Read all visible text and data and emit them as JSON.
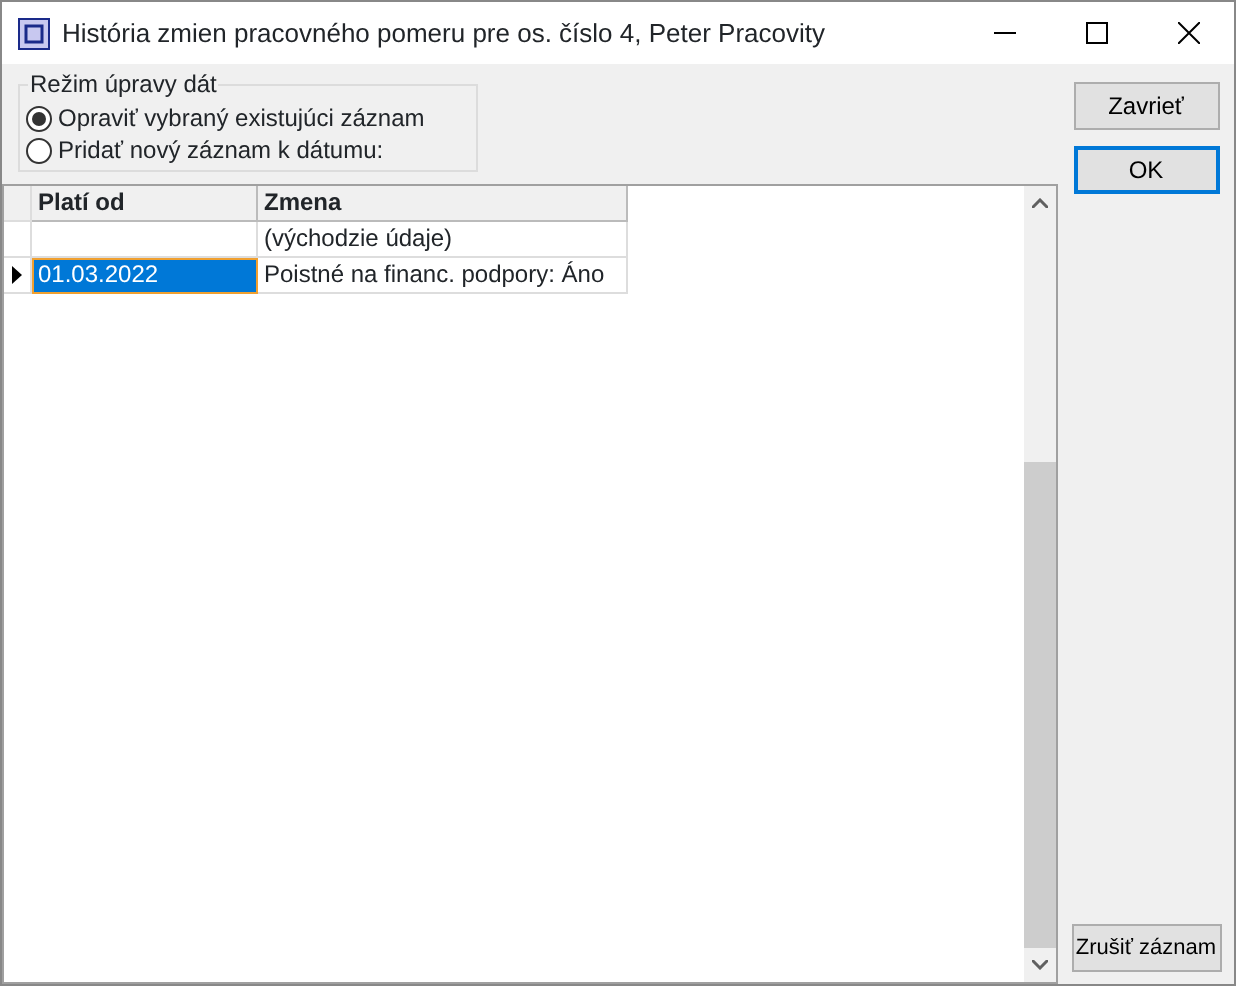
{
  "window": {
    "title": "História zmien pracovného pomeru pre os. číslo 4, Peter Pracovity"
  },
  "mode_group": {
    "title": "Režim úpravy dát",
    "options": [
      {
        "label": "Opraviť vybraný existujúci záznam",
        "selected": true
      },
      {
        "label": "Pridať nový záznam k dátumu:",
        "selected": false
      }
    ]
  },
  "table": {
    "columns": [
      "Platí od",
      "Zmena"
    ],
    "rows": [
      {
        "cells": [
          "",
          "(východzie údaje)"
        ],
        "selected": false
      },
      {
        "cells": [
          "01.03.2022",
          "Poistné na financ. podpory: Áno"
        ],
        "selected": true
      }
    ]
  },
  "buttons": [
    {
      "label": "Zavrieť",
      "default": false
    },
    {
      "label": "OK",
      "default": true
    }
  ],
  "bottom_button": {
    "label": "Zrušiť záznam"
  }
}
